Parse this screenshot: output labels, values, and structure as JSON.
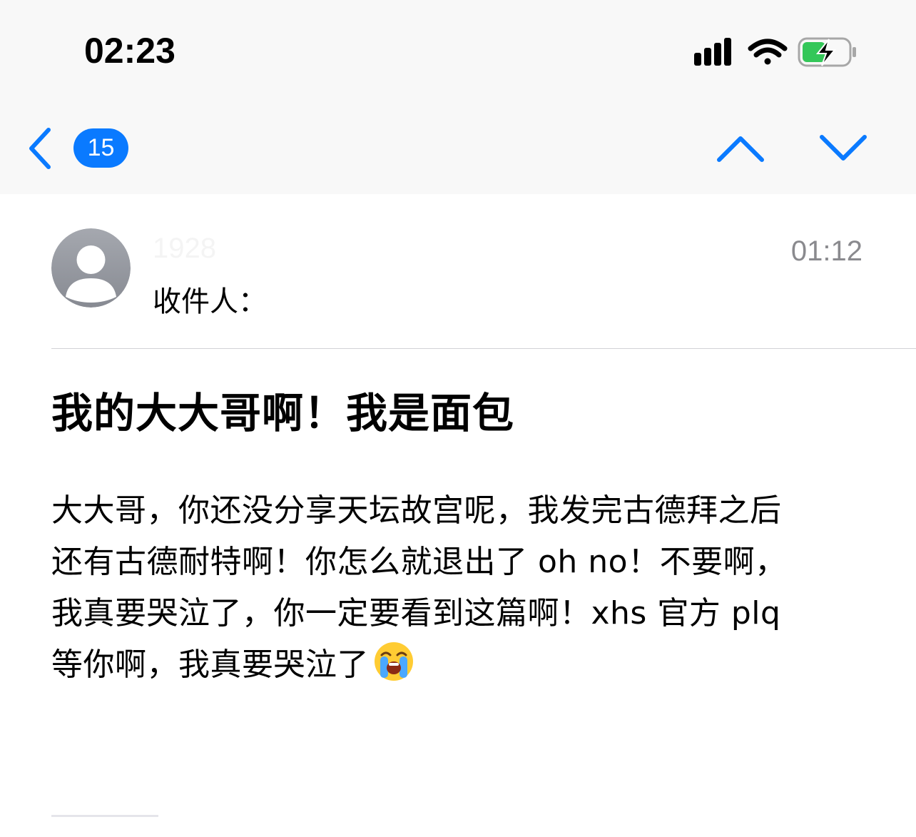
{
  "status_bar": {
    "time": "02:23",
    "icons": [
      "signal-icon",
      "wifi-icon",
      "battery-charging-icon"
    ]
  },
  "nav": {
    "back_icon": "chevron-left-icon",
    "unread_count": "15",
    "up_icon": "chevron-up-icon",
    "down_icon": "chevron-down-icon",
    "accent_color": "#0a7aff"
  },
  "message": {
    "sender": "1928",
    "recipient_label": "收件人：",
    "time": "01:12",
    "subject": "我的大大哥啊！我是面包",
    "body_lines": [
      "大大哥，你还没分享天坛故宫呢，我发完古德拜之后",
      "还有古德耐特啊！你怎么就退出了 oh no！不要啊，",
      "我真要哭泣了，你一定要看到这篇啊！xhs 官方 plq",
      "等你啊，我真要哭泣了"
    ],
    "trailing_emoji": "loudly-crying-face-emoji"
  }
}
